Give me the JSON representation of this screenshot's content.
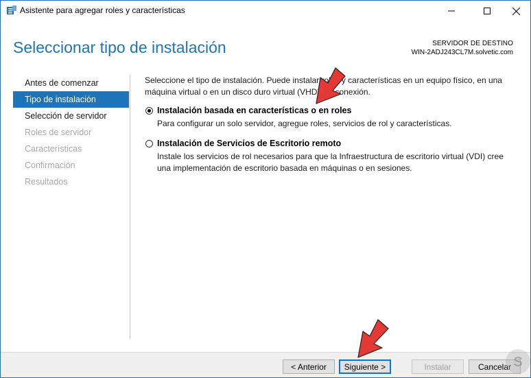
{
  "window": {
    "title": "Asistente para agregar roles y características",
    "icon": "server-manager-icon",
    "controls": [
      "minimize-icon",
      "maximize-icon",
      "close-icon"
    ]
  },
  "header": {
    "page_title": "Seleccionar tipo de instalación",
    "destination_label": "SERVIDOR DE DESTINO",
    "destination_server": "WIN-2ADJ243CL7M.solvetic.com"
  },
  "sidebar": {
    "items": [
      {
        "label": "Antes de comenzar",
        "state": "normal"
      },
      {
        "label": "Tipo de instalación",
        "state": "active"
      },
      {
        "label": "Selección de servidor",
        "state": "normal"
      },
      {
        "label": "Roles de servidor",
        "state": "disabled"
      },
      {
        "label": "Características",
        "state": "disabled"
      },
      {
        "label": "Confirmación",
        "state": "disabled"
      },
      {
        "label": "Resultados",
        "state": "disabled"
      }
    ]
  },
  "main": {
    "intro": "Seleccione el tipo de instalación. Puede instalar roles y características en un equipo físico, en una máquina virtual o en un disco duro virtual (VHD) sin conexión.",
    "options": [
      {
        "title": "Instalación basada en características o en roles",
        "description": "Para configurar un solo servidor, agregue roles, servicios de rol y características.",
        "selected": true
      },
      {
        "title": "Instalación de Servicios de Escritorio remoto",
        "description": "Instale los servicios de rol necesarios para que la Infraestructura de escritorio virtual (VDI) cree una implementación de escritorio basada en máquinas o en sesiones.",
        "selected": false
      }
    ]
  },
  "footer": {
    "prev_label": "< Anterior",
    "next_label": "Siguiente >",
    "install_label": "Instalar",
    "cancel_label": "Cancelar"
  },
  "colors": {
    "accent": "#1e74b8",
    "annotation_arrow": "#e53935"
  }
}
